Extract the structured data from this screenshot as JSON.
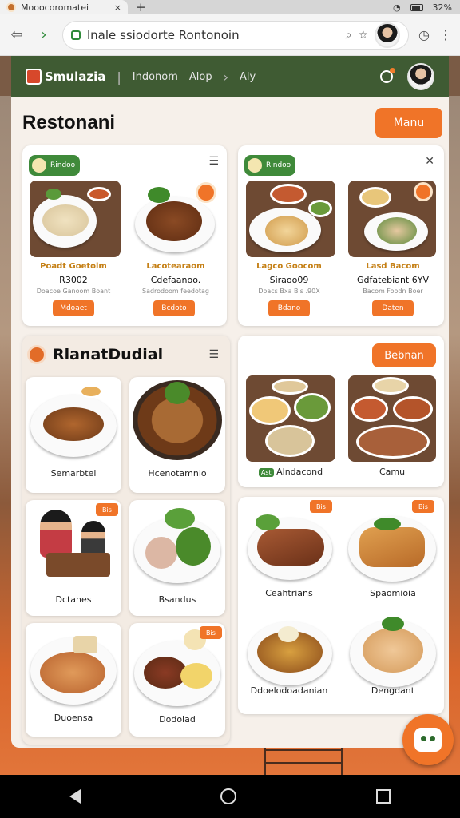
{
  "statusbar": {
    "tab_title": "Mooocoromatei",
    "close": "×",
    "plus": "+",
    "battery": "32%"
  },
  "browser": {
    "url": "lnale ssiodorte Rontonoin",
    "back": "⇦",
    "forward": "›"
  },
  "appbar": {
    "brand": "Smulazia",
    "nav_1": "Indonom",
    "nav_2": "Alop",
    "nav_3": "Aly",
    "sep": "|",
    "chev": "›"
  },
  "page": {
    "title": "Restonani",
    "menu_button": "Manu"
  },
  "top_cards": {
    "left": {
      "badge": "Rindoo",
      "items": [
        {
          "title": "Poadt Goetolm",
          "name": "R3002",
          "sub": "Doacoe Ganoom Boant",
          "button": "Mdoaet"
        },
        {
          "title": "Lacotearaom",
          "name": "Cdefaanoo.",
          "sub": "Sadrodoom feedotag",
          "button": "Bcdoto"
        }
      ]
    },
    "right": {
      "badge": "Rindoo",
      "items": [
        {
          "title": "Lagco Goocom",
          "name": "Siraoo09",
          "sub": "Doacs Bxa Bis .90X",
          "button": "Bdano"
        },
        {
          "title": "Lasd Bacom",
          "name": "Gdfatebiant 6YV",
          "sub": "Bacom Foodn Boer",
          "button": "Daten"
        }
      ]
    }
  },
  "section": {
    "title": "RlanatDudial",
    "grid_left": [
      {
        "caption": "Semarbtel",
        "tag": ""
      },
      {
        "caption": "Hcenotamnio",
        "tag": ""
      },
      {
        "caption": "Dctanes",
        "tag": "Bis"
      },
      {
        "caption": "Bsandus",
        "tag": ""
      },
      {
        "caption": "Duoensa",
        "tag": ""
      },
      {
        "caption": "Dodoiad",
        "tag": "Bis"
      }
    ],
    "right_top": {
      "button": "Bebnan",
      "cap_1": "Alndacond",
      "cap_1_prefix": "Ast",
      "cap_2": "Camu"
    },
    "right_bottom": [
      {
        "caption": "Ceahtrians",
        "tag": "Bis"
      },
      {
        "caption": "Spaomioia",
        "tag": "Bis"
      },
      {
        "caption": "Ddoelodoadanian",
        "tag": ""
      },
      {
        "caption": "Dengdant",
        "tag": ""
      }
    ]
  },
  "colors": {
    "accent": "#f07428",
    "appbar": "#3f5b33",
    "badge": "#3f8a3a"
  },
  "icons": {
    "bell": "bell-icon",
    "fab": "chat-bot-icon",
    "more": "more-icon"
  }
}
